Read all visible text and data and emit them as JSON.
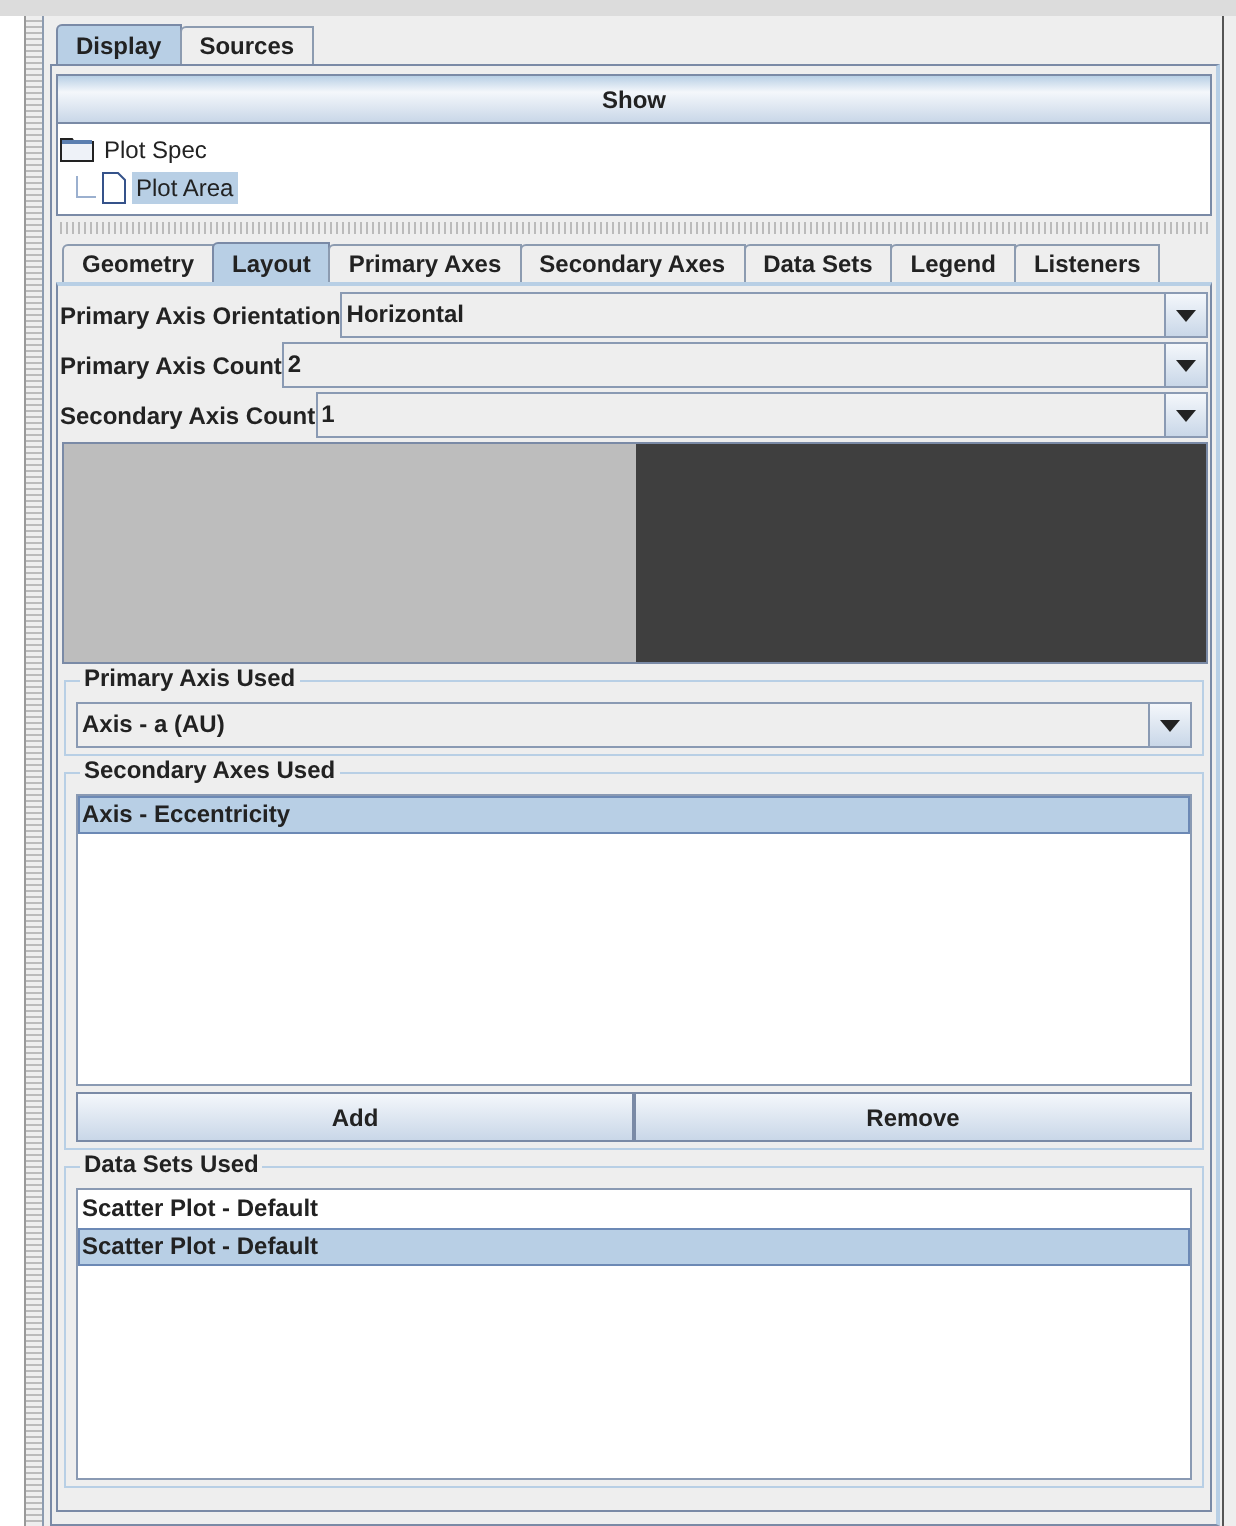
{
  "top_tabs": [
    {
      "label": "Display",
      "selected": true
    },
    {
      "label": "Sources",
      "selected": false
    }
  ],
  "tree_header": "Show",
  "tree": [
    {
      "label": "Plot Spec",
      "kind": "folder",
      "selected": false,
      "children": [
        {
          "label": "Plot Area",
          "kind": "file",
          "selected": true
        }
      ]
    }
  ],
  "tabs": [
    {
      "label": "Geometry",
      "selected": false
    },
    {
      "label": "Layout",
      "selected": true
    },
    {
      "label": "Primary Axes",
      "selected": false
    },
    {
      "label": "Secondary Axes",
      "selected": false
    },
    {
      "label": "Data Sets",
      "selected": false
    },
    {
      "label": "Legend",
      "selected": false
    },
    {
      "label": "Listeners",
      "selected": false
    }
  ],
  "fields": [
    {
      "label": "Primary Axis Orientation",
      "value": "Horizontal"
    },
    {
      "label": "Primary Axis Count",
      "value": "2"
    },
    {
      "label": "Secondary Axis Count",
      "value": "1"
    }
  ],
  "primary_axis_used": {
    "title": "Primary Axis Used",
    "value": "Axis - a (AU)"
  },
  "secondary_axes_used": {
    "title": "Secondary Axes Used",
    "items": [
      {
        "label": "Axis - Eccentricity",
        "selected": true
      }
    ],
    "buttons": [
      "Add",
      "Remove"
    ]
  },
  "data_sets_used": {
    "title": "Data Sets Used",
    "items": [
      {
        "label": "Scatter Plot - Default",
        "selected": false
      },
      {
        "label": "Scatter Plot - Default",
        "selected": true
      }
    ]
  }
}
